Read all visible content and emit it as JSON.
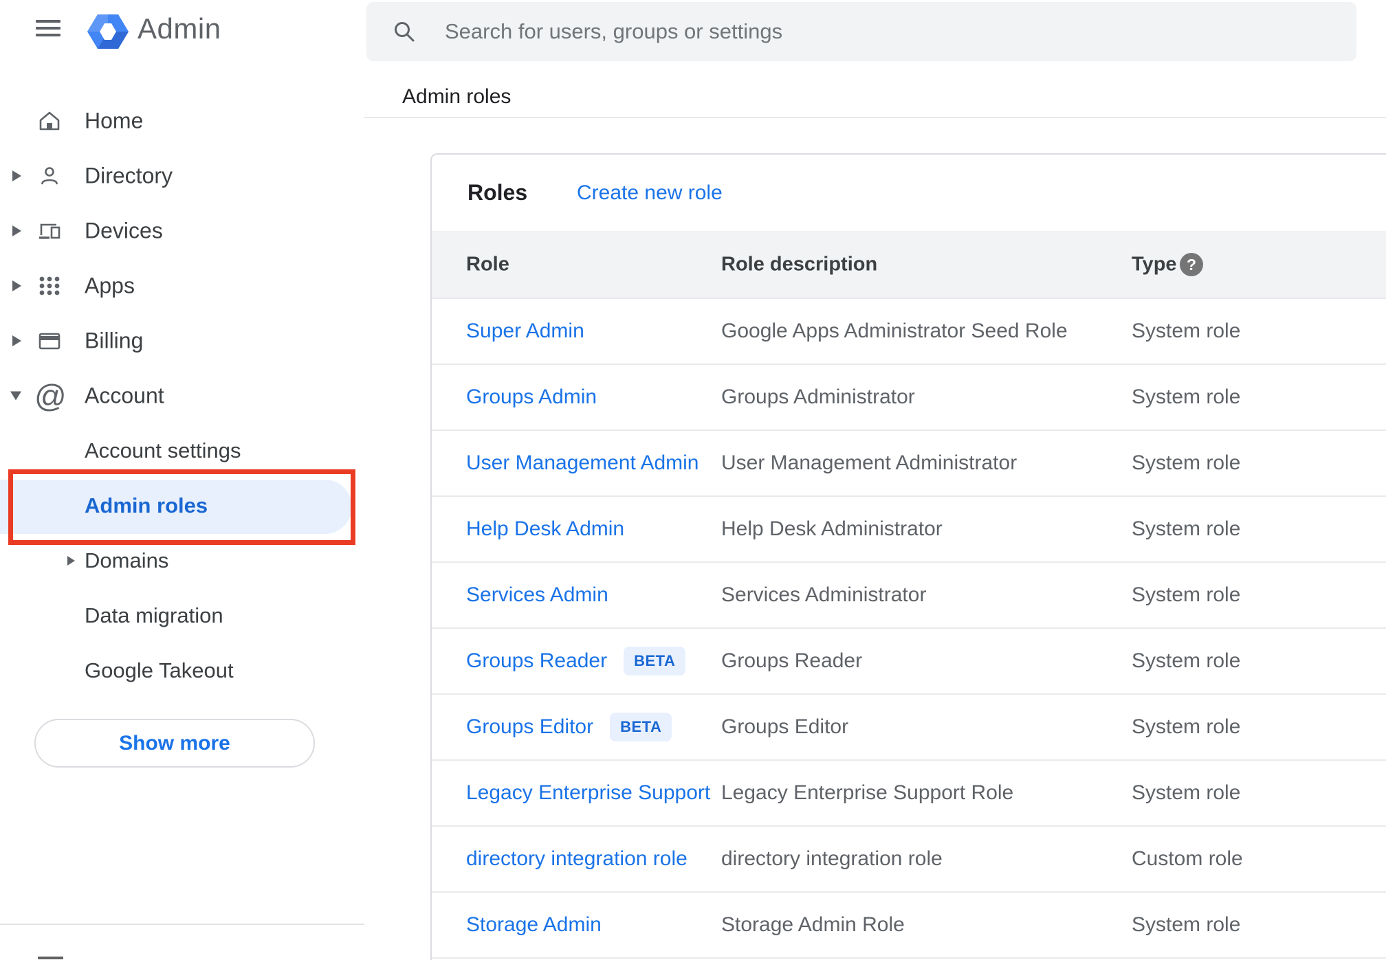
{
  "app": {
    "name": "Admin"
  },
  "search": {
    "placeholder": "Search for users, groups or settings"
  },
  "breadcrumb": {
    "label": "Admin roles"
  },
  "sidebar": {
    "items": [
      {
        "label": "Home"
      },
      {
        "label": "Directory"
      },
      {
        "label": "Devices"
      },
      {
        "label": "Apps"
      },
      {
        "label": "Billing"
      },
      {
        "label": "Account"
      }
    ],
    "subitems": [
      {
        "label": "Account settings"
      },
      {
        "label": "Admin roles"
      },
      {
        "label": "Domains"
      },
      {
        "label": "Data migration"
      },
      {
        "label": "Google Takeout"
      }
    ],
    "show_more": "Show more"
  },
  "icons": {
    "at": "@",
    "help": "?"
  },
  "roles_card": {
    "title": "Roles",
    "create_new_role": "Create new role",
    "columns": {
      "role": "Role",
      "description": "Role description",
      "type": "Type"
    },
    "rows": [
      {
        "role": "Super Admin",
        "description": "Google Apps Administrator Seed Role",
        "type": "System role"
      },
      {
        "role": "Groups Admin",
        "description": "Groups Administrator",
        "type": "System role"
      },
      {
        "role": "User Management Admin",
        "description": "User Management Administrator",
        "type": "System role"
      },
      {
        "role": "Help Desk Admin",
        "description": "Help Desk Administrator",
        "type": "System role"
      },
      {
        "role": "Services Admin",
        "description": "Services Administrator",
        "type": "System role"
      },
      {
        "role": "Groups Reader",
        "badge": "BETA",
        "description": "Groups Reader",
        "type": "System role"
      },
      {
        "role": "Groups Editor",
        "badge": "BETA",
        "description": "Groups Editor",
        "type": "System role"
      },
      {
        "role": "Legacy Enterprise Support",
        "description": "Legacy Enterprise Support Role",
        "type": "System role"
      },
      {
        "role": "directory integration role",
        "description": "directory integration role",
        "type": "Custom role"
      },
      {
        "role": "Storage Admin",
        "description": "Storage Admin Role",
        "type": "System role"
      }
    ]
  },
  "colors": {
    "link_blue": "#1a73e8",
    "selected_blue": "#1967d2",
    "selected_bg": "#e8f0fe",
    "header_bg": "#f1f3f4",
    "annotation_red": "#ea3c24",
    "logo_blue": "#4285f4"
  }
}
